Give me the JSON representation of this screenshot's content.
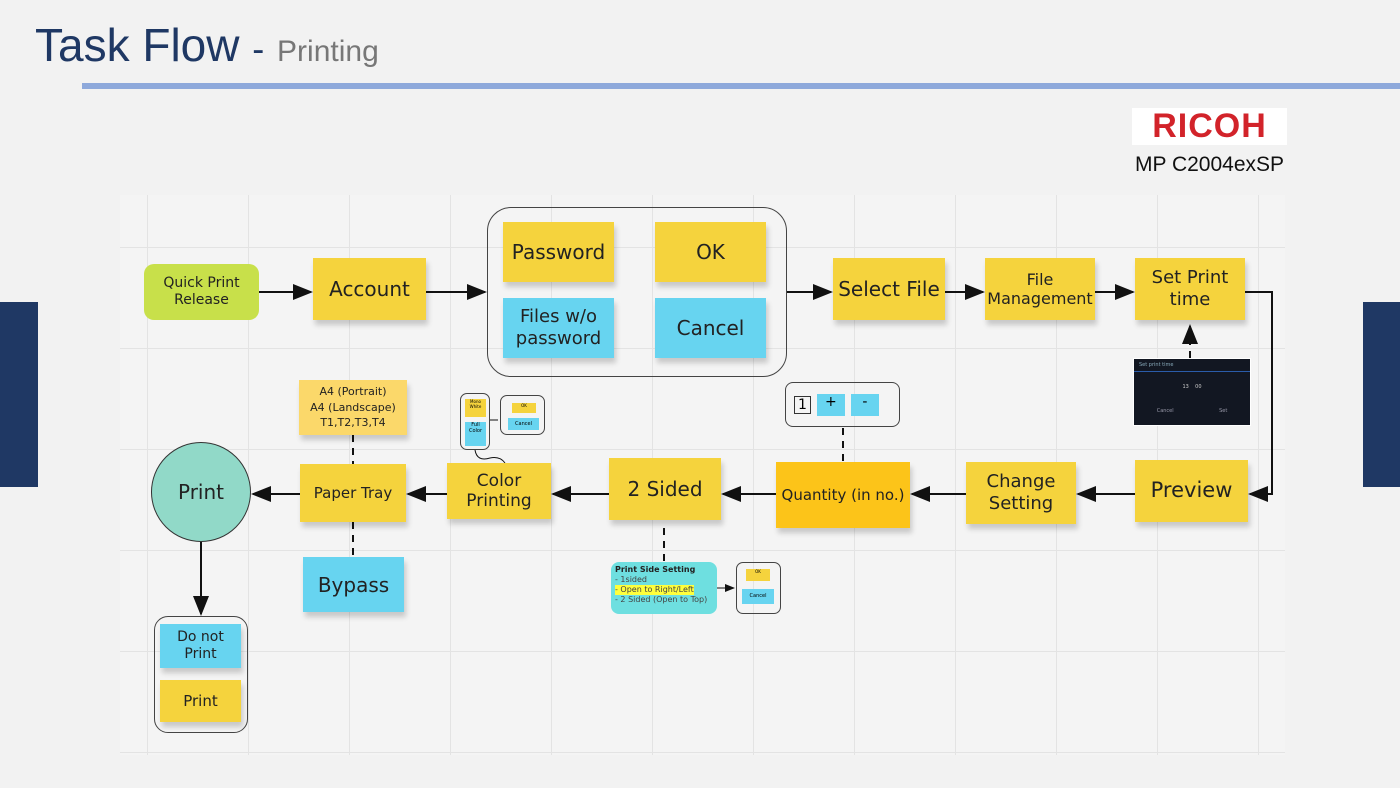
{
  "header": {
    "title": "Task Flow",
    "separator": "-",
    "subtitle": "Printing"
  },
  "brand": {
    "logo": "RICOH",
    "model": "MP C2004exSP"
  },
  "nodes": {
    "quick_print": "Quick Print Release",
    "account": "Account",
    "password": "Password",
    "ok": "OK",
    "files_wo_password": "Files w/o password",
    "cancel": "Cancel",
    "select_file": "Select File",
    "file_management": "File Management",
    "set_print_time": "Set Print time",
    "preview": "Preview",
    "change_setting": "Change Setting",
    "quantity": "Quantity (in no.)",
    "quantity_value": "1",
    "plus": "+",
    "minus": "-",
    "two_sided": "2 Sided",
    "color_printing": "Color Printing",
    "paper_tray": "Paper Tray",
    "paper_options": [
      "A4 (Portrait)",
      "A4 (Landscape)",
      "T1,T2,T3,T4"
    ],
    "bypass": "Bypass",
    "print": "Print",
    "do_not_print": "Do not Print",
    "print_option": "Print"
  },
  "print_side": {
    "title": "Print Side Setting",
    "options": [
      "- 1sided",
      "- Open to Right/Left",
      "- 2 Sided (Open to Top)"
    ],
    "highlight_color": "#ffff3c"
  },
  "mini_color": {
    "mono": "Mono White",
    "full": "Full Color",
    "ok": "OK",
    "cancel": "Cancel"
  },
  "mini_side": {
    "ok": "OK",
    "cancel": "Cancel"
  },
  "time_screen": {
    "title": "Set print time",
    "hour": "13",
    "minute": "00",
    "cancel": "Cancel",
    "set": "Set"
  },
  "colors": {
    "navy": "#1f3864",
    "sticky_yellow": "#f5d33d",
    "sticky_cyan": "#67d4f0",
    "start_green": "#c8e04a",
    "print_circle": "#91d9c8"
  }
}
